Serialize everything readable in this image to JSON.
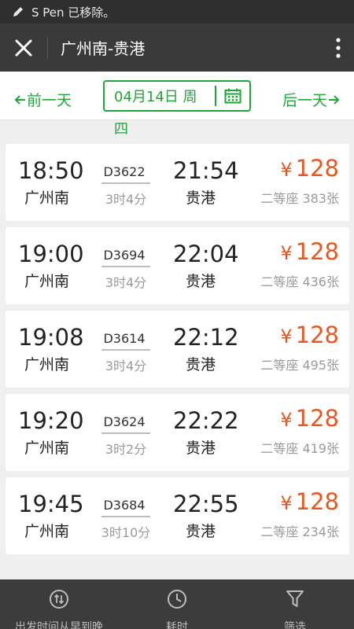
{
  "status": {
    "text": "S Pen 已移除。"
  },
  "header": {
    "title": "广州南-贵港"
  },
  "date_nav": {
    "prev_label": "前一天",
    "next_label": "后一天",
    "date_visible": "04月14日 周",
    "date_overflow": "四"
  },
  "trains": [
    {
      "depart_time": "18:50",
      "depart_station": "广州南",
      "train_no": "D3622",
      "duration": "3时4分",
      "arrive_time": "21:54",
      "arrive_station": "贵港",
      "currency": "¥",
      "price": "128",
      "seat_info": "二等座 383张"
    },
    {
      "depart_time": "19:00",
      "depart_station": "广州南",
      "train_no": "D3694",
      "duration": "3时4分",
      "arrive_time": "22:04",
      "arrive_station": "贵港",
      "currency": "¥",
      "price": "128",
      "seat_info": "二等座 436张"
    },
    {
      "depart_time": "19:08",
      "depart_station": "广州南",
      "train_no": "D3614",
      "duration": "3时4分",
      "arrive_time": "22:12",
      "arrive_station": "贵港",
      "currency": "¥",
      "price": "128",
      "seat_info": "二等座 495张"
    },
    {
      "depart_time": "19:20",
      "depart_station": "广州南",
      "train_no": "D3624",
      "duration": "3时2分",
      "arrive_time": "22:22",
      "arrive_station": "贵港",
      "currency": "¥",
      "price": "128",
      "seat_info": "二等座 419张"
    },
    {
      "depart_time": "19:45",
      "depart_station": "广州南",
      "train_no": "D3684",
      "duration": "3时10分",
      "arrive_time": "22:55",
      "arrive_station": "贵港",
      "currency": "¥",
      "price": "128",
      "seat_info": "二等座 234张"
    }
  ],
  "bottom_tabs": [
    {
      "label": "出发时间从早到晚",
      "icon": "sort-icon"
    },
    {
      "label": "耗时",
      "icon": "clock-icon"
    },
    {
      "label": "筛选",
      "icon": "filter-icon"
    }
  ],
  "colors": {
    "accent": "#21a639",
    "price": "#e8571e",
    "header_bg": "#3a3a3a"
  }
}
